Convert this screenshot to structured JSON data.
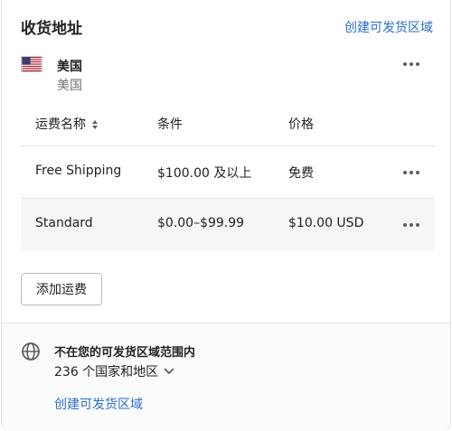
{
  "header": {
    "title": "收货地址",
    "create_zone_link": "创建可发货区域"
  },
  "zone": {
    "flag_icon": "us-flag-icon",
    "name": "美国",
    "subtitle": "美国",
    "menu_icon": "more-horizontal-icon"
  },
  "rates_table": {
    "columns": [
      "运费名称",
      "条件",
      "价格"
    ],
    "sort_icon": "sort-icon",
    "rows": [
      {
        "name": "Free Shipping",
        "condition": "$100.00 及以上",
        "price": "免费"
      },
      {
        "name": "Standard",
        "condition": "$0.00–$99.99",
        "price": "$10.00 USD"
      }
    ]
  },
  "add_rate_button": "添加运费",
  "rest_of_world": {
    "icon": "globe-icon",
    "title": "不在您的可发货区域范围内",
    "count": "236 个国家和地区",
    "create_zone_link": "创建可发货区域"
  },
  "colors": {
    "link": "#2c6ecb",
    "text": "#202223",
    "subdued": "#6d7175",
    "border": "#e1e3e5",
    "row_highlight": "#f6f6f7"
  }
}
